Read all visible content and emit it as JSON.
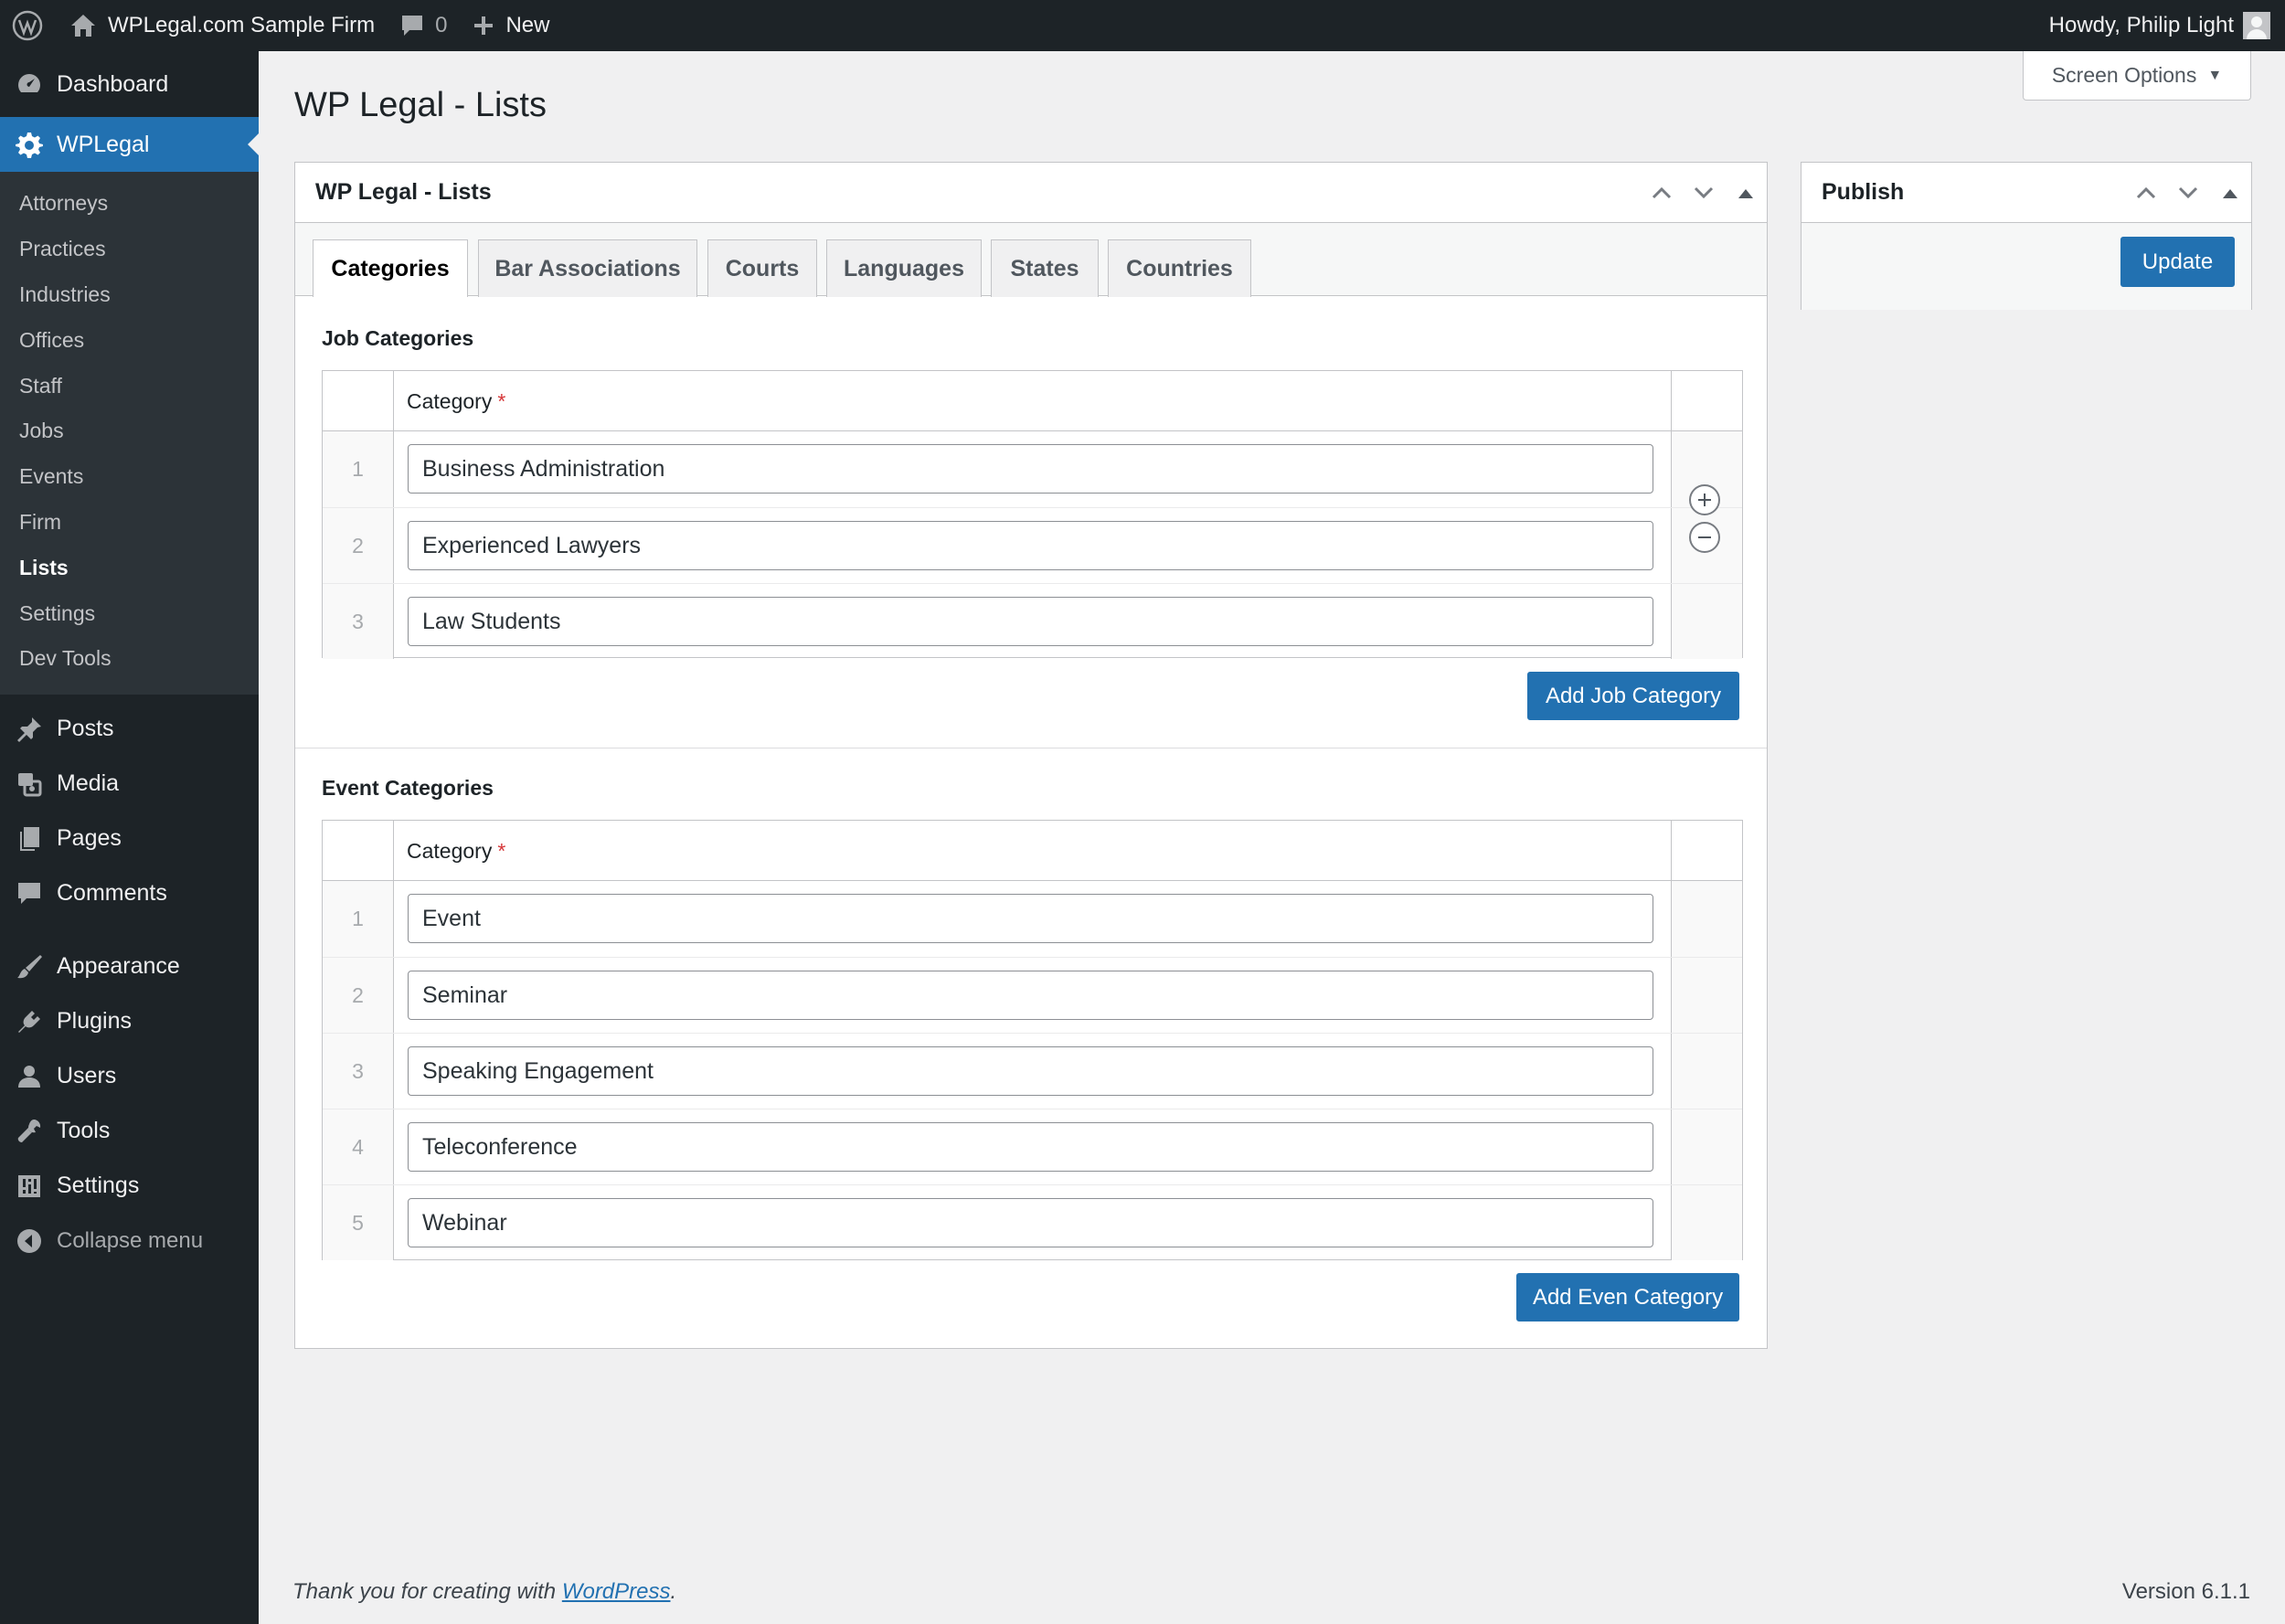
{
  "adminbar": {
    "site_name": "WPLegal.com Sample Firm",
    "comments_count": "0",
    "new_label": "New",
    "greeting": "Howdy, Philip Light"
  },
  "sidebar": {
    "top_items": [
      {
        "label": "Dashboard",
        "icon": "dashboard-icon"
      },
      {
        "label": "WPLegal",
        "icon": "gear-icon"
      }
    ],
    "submenu": [
      "Attorneys",
      "Practices",
      "Industries",
      "Offices",
      "Staff",
      "Jobs",
      "Events",
      "Firm",
      "Lists",
      "Settings",
      "Dev Tools"
    ],
    "current_sub": "Lists",
    "bottom_items": [
      {
        "label": "Posts",
        "icon": "pin-icon"
      },
      {
        "label": "Media",
        "icon": "media-icon"
      },
      {
        "label": "Pages",
        "icon": "pages-icon"
      },
      {
        "label": "Comments",
        "icon": "comment-icon"
      },
      {
        "label": "Appearance",
        "icon": "brush-icon"
      },
      {
        "label": "Plugins",
        "icon": "plugin-icon"
      },
      {
        "label": "Users",
        "icon": "user-icon"
      },
      {
        "label": "Tools",
        "icon": "wrench-icon"
      },
      {
        "label": "Settings",
        "icon": "settings-icon"
      }
    ],
    "collapse_label": "Collapse menu"
  },
  "header": {
    "page_title": "WP Legal - Lists",
    "screen_options": "Screen Options"
  },
  "main_box": {
    "title": "WP Legal - Lists",
    "tabs": [
      "Categories",
      "Bar Associations",
      "Courts",
      "Languages",
      "States",
      "Countries"
    ],
    "active_tab": "Categories",
    "job_section": {
      "label": "Job Categories",
      "column_label": "Category",
      "required_mark": "*",
      "rows": [
        "Business Administration",
        "Experienced Lawyers",
        "Law Students"
      ],
      "button_label": "Add Job Category"
    },
    "event_section": {
      "label": "Event Categories",
      "column_label": "Category",
      "required_mark": "*",
      "rows": [
        "Event",
        "Seminar",
        "Speaking Engagement",
        "Teleconference",
        "Webinar"
      ],
      "button_label": "Add Even Category"
    }
  },
  "publish_box": {
    "title": "Publish",
    "update_label": "Update"
  },
  "footer": {
    "thanks_prefix": "Thank you for creating with ",
    "thanks_link": "WordPress",
    "thanks_suffix": ".",
    "version": "Version 6.1.1"
  },
  "colors": {
    "accent": "#2271b1",
    "admin_bg": "#1d2327",
    "required": "#d63638"
  }
}
